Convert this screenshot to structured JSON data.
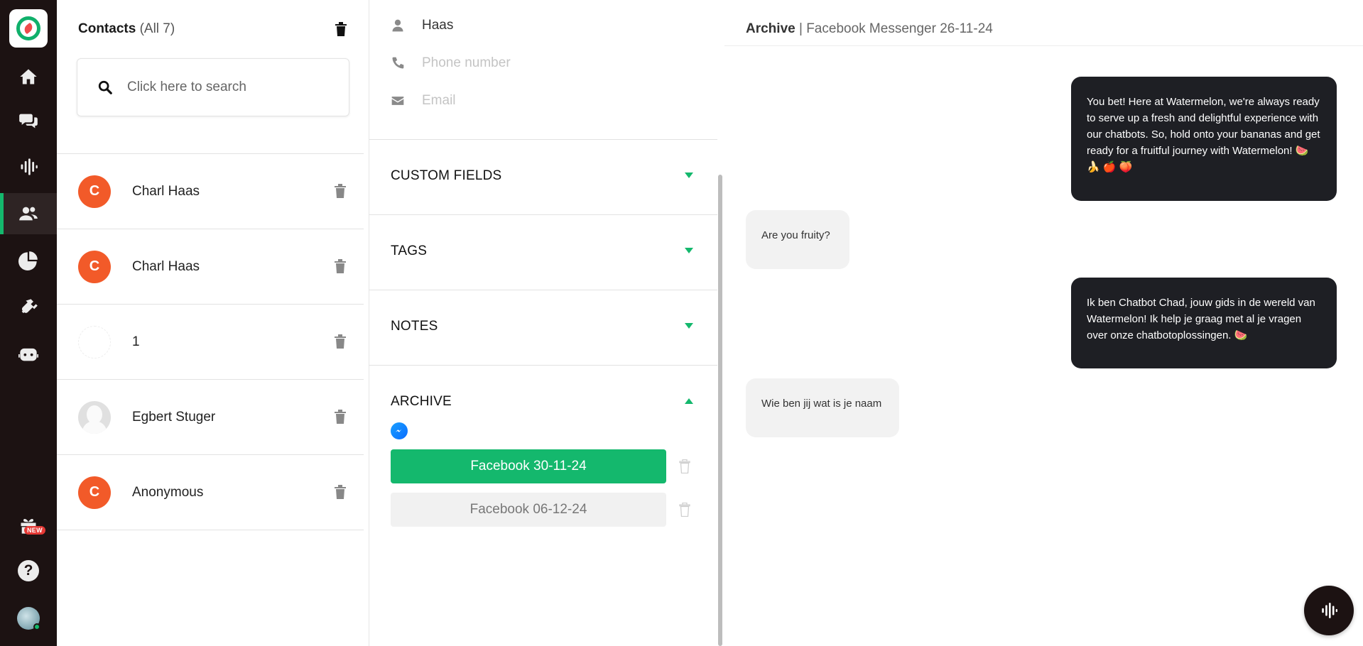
{
  "contacts": {
    "title": "Contacts",
    "count": "(All 7)",
    "search_placeholder": "Click here to search",
    "items": [
      {
        "name": "Charl Haas",
        "avatar_type": "initial",
        "initial": "C"
      },
      {
        "name": "Charl Haas",
        "avatar_type": "initial",
        "initial": "C"
      },
      {
        "name": "1",
        "avatar_type": "blank",
        "initial": ""
      },
      {
        "name": "Egbert Stuger",
        "avatar_type": "photo",
        "initial": ""
      },
      {
        "name": "Anonymous",
        "avatar_type": "initial",
        "initial": "C"
      }
    ]
  },
  "details": {
    "name_value": "Haas",
    "phone_placeholder": "Phone number",
    "email_placeholder": "Email",
    "sections": {
      "custom_fields": "CUSTOM FIELDS",
      "tags": "TAGS",
      "notes": "NOTES",
      "archive": "ARCHIVE"
    },
    "archive_items": [
      {
        "label": "Facebook 30-11-24",
        "selected": true
      },
      {
        "label": "Facebook 06-12-24",
        "selected": false
      }
    ]
  },
  "chat": {
    "title": "Archive",
    "separator": " | ",
    "subtitle": "Facebook Messenger 26-11-24",
    "messages": [
      {
        "direction": "out",
        "text": "You bet! Here at Watermelon, we're always ready to serve up a fresh and delightful experience with our chatbots. So, hold onto your bananas and get ready for a fruitful journey with Watermelon! 🍉 🍌 🍎 🍑"
      },
      {
        "direction": "in",
        "text": "Are you fruity?"
      },
      {
        "direction": "out",
        "text": "Ik ben Chatbot Chad, jouw gids in de wereld van Watermelon! Ik help je graag met al je vragen over onze chatbotoplossingen. 🍉"
      },
      {
        "direction": "in",
        "text": "Wie ben jij wat is je naam"
      }
    ]
  },
  "rail": {
    "items": [
      "home-icon",
      "chat-icon",
      "audio-icon",
      "contacts-icon",
      "analytics-icon",
      "integrations-icon",
      "bot-icon",
      "gift-icon",
      "help-icon",
      "user-avatar"
    ],
    "new_badge": "NEW",
    "help_glyph": "?"
  },
  "colors": {
    "accent": "#14b86d",
    "rail_bg": "#1c1212",
    "avatar_orange": "#f25a29",
    "bubble_dark": "#1e1f24",
    "bubble_light": "#f2f2f2"
  }
}
